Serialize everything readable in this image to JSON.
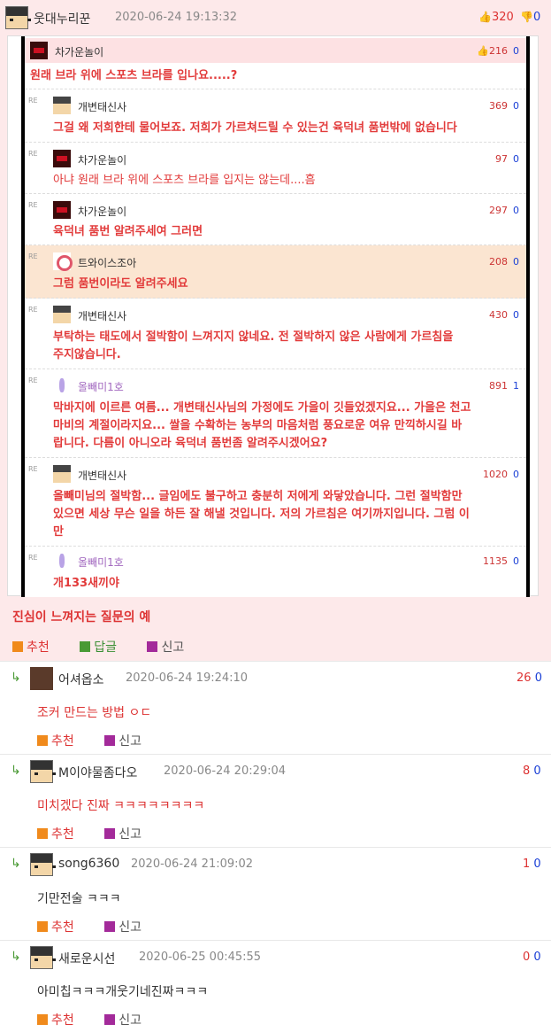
{
  "post": {
    "nick": "웃대누리꾼",
    "date": "2020-06-24 19:13:32",
    "up_votes": "320",
    "down_votes": "0",
    "caption": "진심이 느껴지는 질문의 예",
    "actions": {
      "recommend": "추천",
      "reply": "답글",
      "report": "신고"
    }
  },
  "screenshot": {
    "top": {
      "nick": "차가운놀이",
      "up": "216",
      "down": "0",
      "text": "원래 브라 위에 스포츠 브라를 입나요.....?"
    },
    "re_label": "RE",
    "comments": [
      {
        "nick": "개변태신사",
        "score": "369",
        "down": "0",
        "text": "그걸 왜 저희한테 물어보죠. 저희가 가르쳐드릴 수 있는건 육덕녀 품번밖에 없습니다"
      },
      {
        "nick": "차가운놀이",
        "score": "97",
        "down": "0",
        "text": "아냐 원래 브라 위에 스포츠 브라를 입지는 않는데....흠"
      },
      {
        "nick": "차가운놀이",
        "score": "297",
        "down": "0",
        "text": "육덕녀 품번 알려주세여 그러면"
      },
      {
        "nick": "트와이스조아",
        "score": "208",
        "down": "0",
        "text": "그럼 품번이라도 알려주세요"
      },
      {
        "nick": "개변태신사",
        "score": "430",
        "down": "0",
        "text1": "부탁하는 태도에서 절박함이 느껴지지 않네요. 전 절박하지 않은 사람에게 가르침을",
        "text2": "주지않습니다."
      },
      {
        "nick": "올빼미1호",
        "score": "891",
        "down": "1",
        "text1": "막바지에 이르른 여름... 개변태신사님의 가정에도 가을이 깃들었겠지요... 가을은 천고",
        "text2": "마비의 계절이라지요... 쌀을 수확하는 농부의 마음처럼 풍요로운 여유 만끽하시길 바",
        "text3": "랍니다. 다름이 아니오라 육덕녀 품번좀 알려주시겠어요?"
      },
      {
        "nick": "개변태신사",
        "score": "1020",
        "down": "0",
        "text1": "올빼미님의 절박함... 글임에도 불구하고 충분히 저에게 와닿았습니다. 그런 절박함만",
        "text2": "있으면 세상 무슨 일을 하든 잘 해낼 것입니다. 저의 가르침은 여기까지입니다. 그럼 이",
        "text3": "만"
      },
      {
        "nick": "올빼미1호",
        "score": "1135",
        "down": "0",
        "text": "개133새끼야"
      }
    ]
  },
  "replies": [
    {
      "nick": "어셔옵소",
      "date": "2020-06-24 19:24:10",
      "up": "26",
      "down": "0",
      "text": "조커 만드는 방법 ㅇㄷ",
      "recommend": "추천",
      "report": "신고"
    },
    {
      "nick": "M이야물좀다오",
      "date": "2020-06-24 20:29:04",
      "up": "8",
      "down": "0",
      "text": "미치겠다 진짜 ㅋㅋㅋㅋㅋㅋㅋㅋ",
      "recommend": "추천",
      "report": "신고"
    },
    {
      "nick": "song6360",
      "date": "2020-06-24 21:09:02",
      "up": "1",
      "down": "0",
      "text": "기만전술 ㅋㅋㅋ",
      "recommend": "추천",
      "report": "신고"
    },
    {
      "nick": "새로운시선",
      "date": "2020-06-25 00:45:55",
      "up": "0",
      "down": "0",
      "text": "아미칩ㅋㅋㅋ개웃기네진짜ㅋㅋㅋ",
      "recommend": "추천",
      "report": "신고"
    }
  ]
}
